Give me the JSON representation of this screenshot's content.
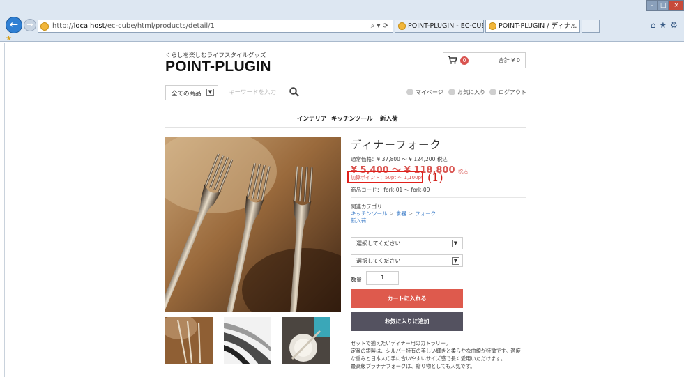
{
  "browser": {
    "url_prefix": "http://",
    "url_host": "localhost",
    "url_path": "/ec-cube/html/products/detail/1",
    "addr_tools": "⌕ ▾ ⟳",
    "tabs": [
      {
        "label": "POINT-PLUGIN - EC-CUBE..."
      },
      {
        "label": "POINT-PLUGIN / ディナ..."
      }
    ],
    "tab_close": "×",
    "nav_back": "←",
    "nav_forward": "→",
    "window_min": "–",
    "window_max": "□",
    "window_close": "×",
    "toolbar_icons": "⌂★⚙"
  },
  "header": {
    "tagline": "くらしを楽しむライフスタイルグッズ",
    "logo": "POINT-PLUGIN",
    "cart_icon": "🛒",
    "cart_count": "0",
    "cart_total": "合計 ¥ 0"
  },
  "search": {
    "category_label": "全ての商品",
    "category_arrow": "▼",
    "placeholder": "キーワードを入力"
  },
  "user_links": {
    "mypage": "マイページ",
    "favorite": "お気に入り",
    "logout": "ログアウト"
  },
  "nav": {
    "interior": "インテリア",
    "kitchen": "キッチンツール",
    "new": "新入荷"
  },
  "product": {
    "title": "ディナーフォーク",
    "regular_price": "通常価格：¥ 37,800 ～ ¥ 124,200 税込",
    "sale_price": "¥ 5,400 ～ ¥ 118,800",
    "sale_tax": "税込",
    "point": "加算ポイント：50pt ～ 1,100pt",
    "annotation": "(1)",
    "code": "商品コード： fork-01 ～ fork-09",
    "related_heading": "関連カテゴリ",
    "related_kitchen": "キッチンツール",
    "related_sep": ">",
    "related_tableware": "食器",
    "related_fork": "フォーク",
    "related_new": "新入荷",
    "option_1": "選択してください",
    "option_2": "選択してください",
    "option_arrow": "▼",
    "quantity_label": "数量",
    "quantity_value": "1",
    "add_to_cart": "カートに入れる",
    "add_favorite": "お気に入りに追加",
    "description": [
      "セットで揃えたいディナー用のカトラリー。",
      "定番の銀製は、シルバー特有の美しい輝きと柔らかな曲線が特徴です。適度",
      "な重みと日本人の手に合いやすいサイズ感で長く愛用いただけます。",
      "最高級プラチナフォークは、贈り物としても人気です。"
    ]
  },
  "colors": {
    "accent_red": "#de5a4d",
    "price_red": "#d9534f",
    "favorite_btn": "#545260",
    "link_blue": "#3a7bc8",
    "annotation_red": "#e0201b"
  }
}
